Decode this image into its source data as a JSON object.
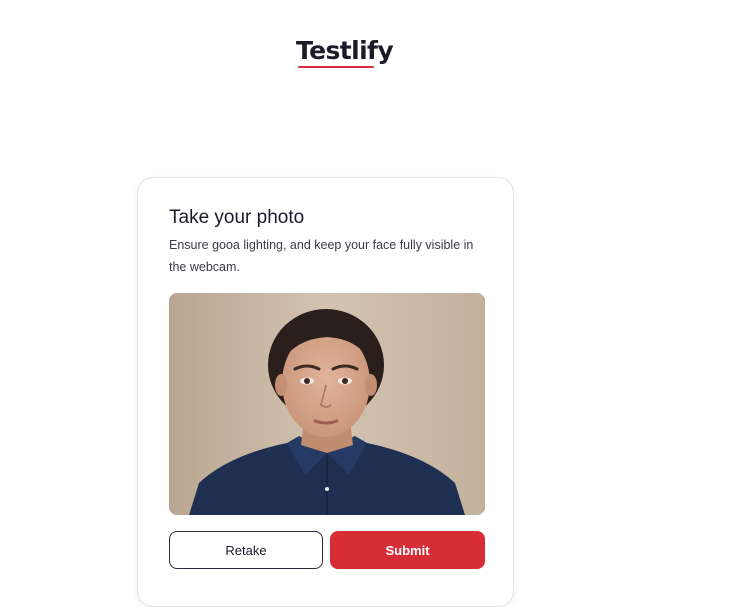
{
  "brand": {
    "name": "Testlify",
    "accent_color": "#d62d36"
  },
  "card": {
    "title": "Take your photo",
    "instructions": "Ensure gooa lighting, and keep your face fully visible in the webcam."
  },
  "photo": {
    "alt": "Captured webcam photo"
  },
  "actions": {
    "retake_label": "Retake",
    "submit_label": "Submit"
  }
}
